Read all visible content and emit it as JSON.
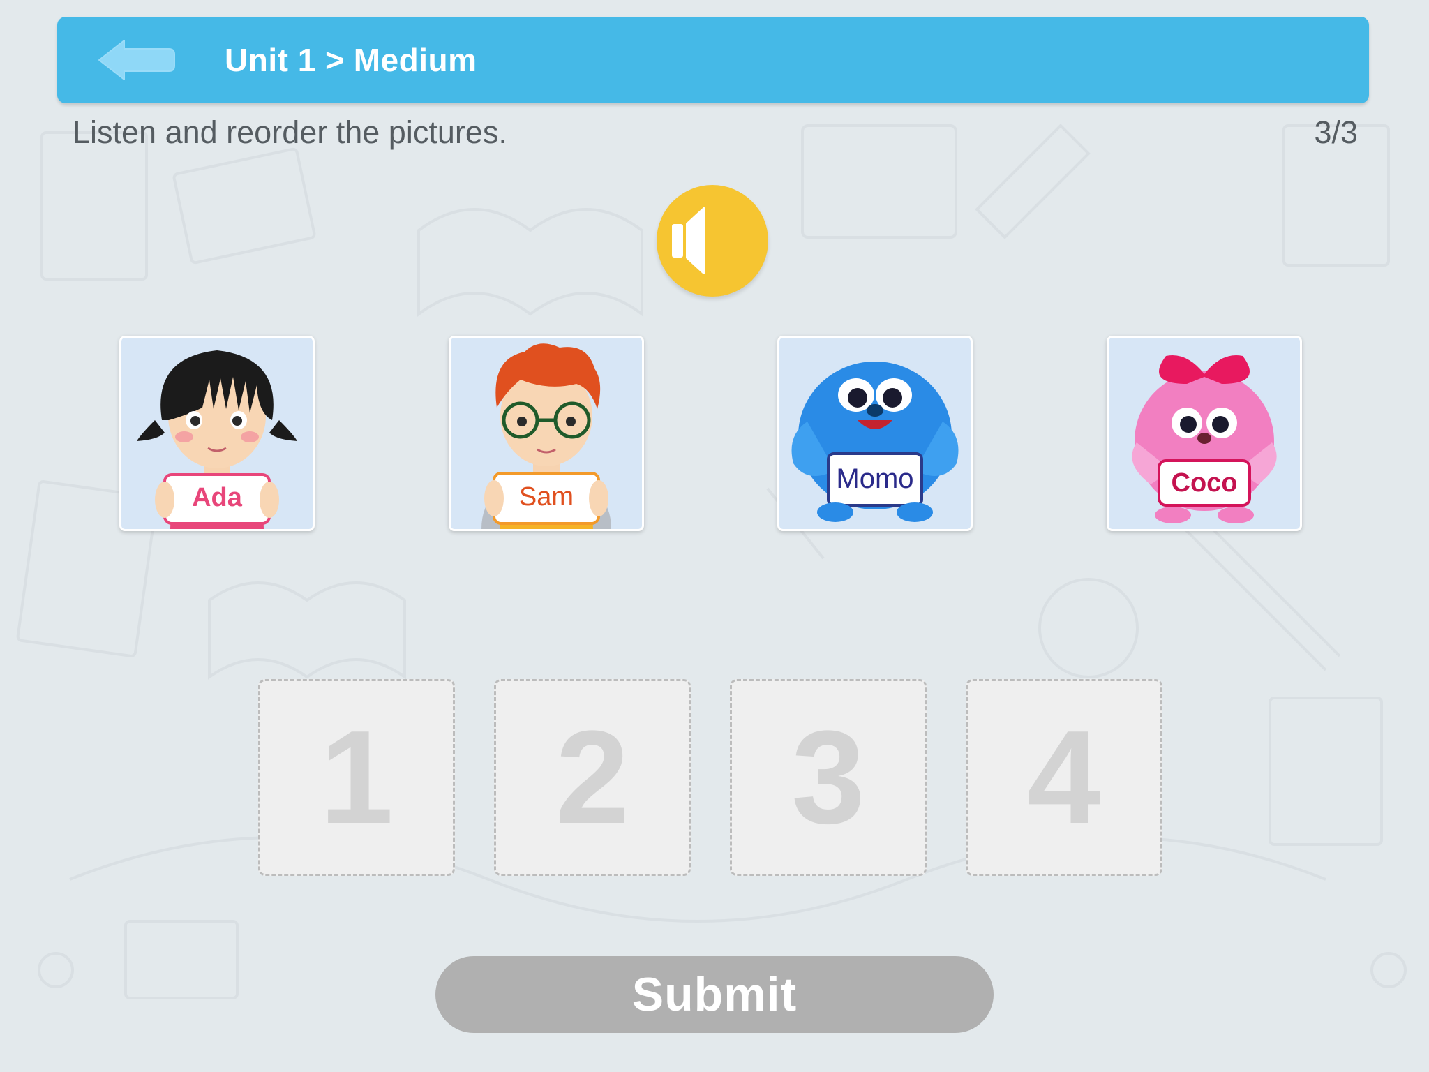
{
  "header": {
    "title": "Unit 1 > Medium",
    "back_icon": "back-arrow-icon",
    "color": "#45b9e7"
  },
  "question": {
    "instruction": "Listen and reorder the pictures.",
    "progress": "3/3"
  },
  "audio": {
    "icon": "speaker-icon",
    "color": "#f6c531"
  },
  "cards": [
    {
      "name": "Ada",
      "character": "girl"
    },
    {
      "name": "Sam",
      "character": "boy"
    },
    {
      "name": "Momo",
      "character": "blue-monster"
    },
    {
      "name": "Coco",
      "character": "pink-monster"
    }
  ],
  "slots": [
    "1",
    "2",
    "3",
    "4"
  ],
  "submit": {
    "label": "Submit",
    "enabled": false
  }
}
